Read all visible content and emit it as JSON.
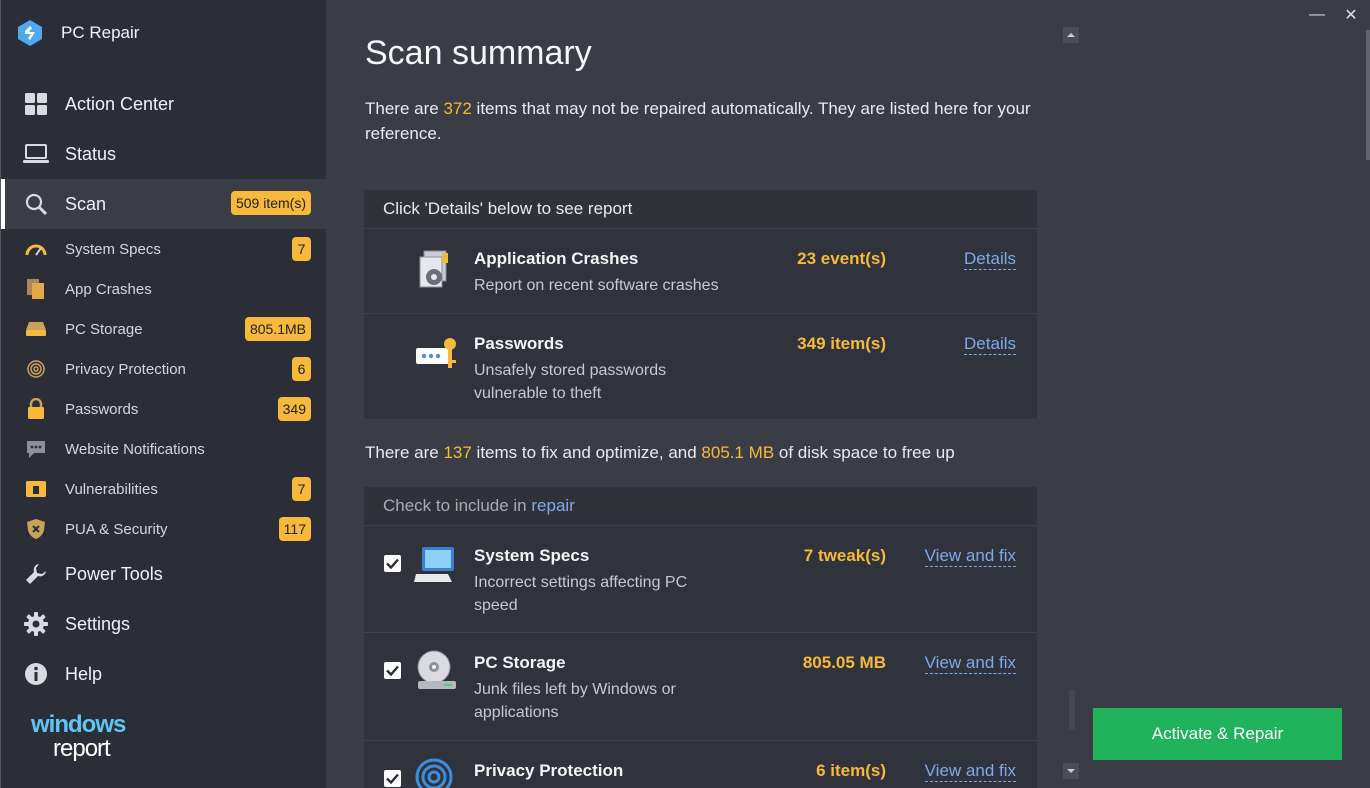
{
  "app": {
    "title": "PC Repair"
  },
  "sidebar": {
    "main_items": [
      {
        "label": "Action Center"
      },
      {
        "label": "Status"
      },
      {
        "label": "Scan",
        "badge": "509 item(s)"
      },
      {
        "label": "Power Tools"
      },
      {
        "label": "Settings"
      },
      {
        "label": "Help"
      }
    ],
    "sub_items": [
      {
        "label": "System Specs",
        "badge": "7"
      },
      {
        "label": "App Crashes",
        "badge": ""
      },
      {
        "label": "PC Storage",
        "badge": "805.1MB"
      },
      {
        "label": "Privacy Protection",
        "badge": "6"
      },
      {
        "label": "Passwords",
        "badge": "349"
      },
      {
        "label": "Website Notifications",
        "badge": ""
      },
      {
        "label": "Vulnerabilities",
        "badge": "7"
      },
      {
        "label": "PUA & Security",
        "badge": "117"
      }
    ],
    "brand": {
      "line1": "windows",
      "line2": "report"
    }
  },
  "main": {
    "title": "Scan summary",
    "intro": {
      "prefix": "There are ",
      "count": "372",
      "suffix": " items that may not be repaired automatically. They are listed here for your reference."
    },
    "report_panel": {
      "header": "Click 'Details' below to see report",
      "rows": [
        {
          "title": "Application Crashes",
          "desc": "Report on recent software crashes",
          "count": "23 event(s)",
          "link": "Details"
        },
        {
          "title": "Passwords",
          "desc": "Unsafely stored passwords vulnerable to theft",
          "count": "349 item(s)",
          "link": "Details"
        }
      ]
    },
    "summary": {
      "prefix": "There are ",
      "items": "137",
      "middle": " items to fix and optimize, and ",
      "size": "805.1 MB",
      "suffix": " of disk  space to free up"
    },
    "repair_panel": {
      "header_prefix": "Check to include in ",
      "header_link": "repair",
      "rows": [
        {
          "title": "System Specs",
          "desc": "Incorrect settings affecting PC speed",
          "count": "7 tweak(s)",
          "link": "View and fix",
          "checked": true
        },
        {
          "title": "PC Storage",
          "desc": "Junk files left by Windows or applications",
          "count": "805.05 MB",
          "link": "View and fix",
          "checked": true
        },
        {
          "title": "Privacy Protection",
          "desc": "",
          "count": "6 item(s)",
          "link": "View and fix",
          "checked": true
        }
      ]
    }
  },
  "actions": {
    "activate_repair": "Activate & Repair"
  },
  "window": {
    "minimize": "—",
    "close": "✕"
  },
  "colors": {
    "accent": "#f6b93b",
    "link": "#7fa8ec",
    "cta": "#21b25c",
    "sidebar_bg": "#2b2e36",
    "main_bg": "#3a3d46"
  }
}
